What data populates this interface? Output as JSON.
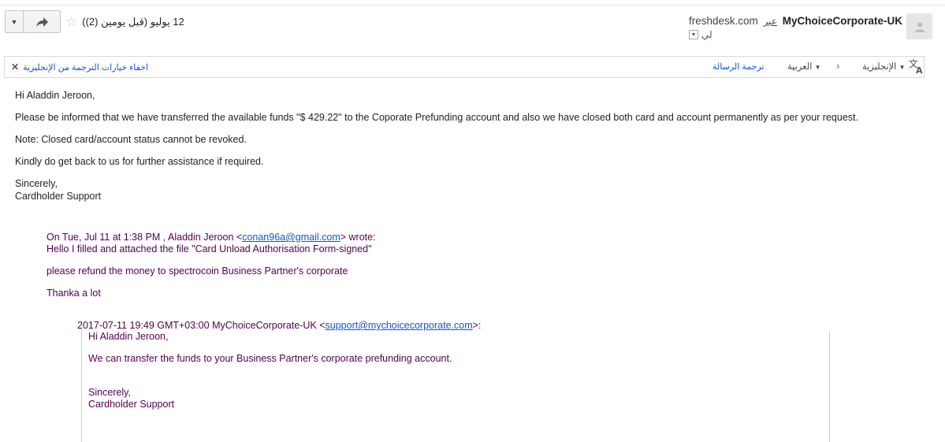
{
  "header": {
    "date": "12 يوليو (قبل يومين (2))",
    "sender_name": "MyChoiceCorporate-UK",
    "via_label": "عبر",
    "sender_domain": "freshdesk.com",
    "to_label": "لي",
    "icons": [
      "reply-dropdown-icon",
      "forward-icon",
      "star-icon",
      "avatar-icon",
      "chevron-down-icon"
    ]
  },
  "translate_bar": {
    "from_lang": "الإنجليزية",
    "to_lang": "العربية",
    "translate_message": "ترجمة الرسالة",
    "hide_options": "اخفاء خيارات الترجمة من الإنجليزية"
  },
  "message": {
    "greeting": "Hi Aladdin Jeroon,",
    "line1": "Please be informed that we have transferred the available funds \"$ 429.22\" to the Coporate Prefunding account and also we have closed both card and account permanently as per your request.",
    "line2": "Note: Closed card/account status cannot be revoked.",
    "line3": "Kindly do get back to us for further assistance if required.",
    "signoff": "Sincerely,",
    "signature": "Cardholder Support"
  },
  "quote1": {
    "attr_prefix": "On Tue, Jul 11 at 1:38 PM , Aladdin Jeroon <",
    "email": "conan96a@gmail.com",
    "attr_suffix": "> wrote:",
    "line1": "Hello I filled and attached the file \"Card Unload Authorisation Form-signed\"",
    "line2": "please refund the money to spectrocoin Business Partner's corporate",
    "line3": "Thanka a lot"
  },
  "quote2": {
    "attr_prefix": "2017-07-11 19:49 GMT+03:00 MyChoiceCorporate-UK <",
    "email": "support@mychoicecorporate.com",
    "attr_suffix": ">:",
    "greeting": "Hi Aladdin Jeroon,",
    "line1": "We can transfer the funds to your Business Partner's corporate prefunding account.",
    "signoff": "Sincerely,",
    "signature": "Cardholder Support"
  }
}
